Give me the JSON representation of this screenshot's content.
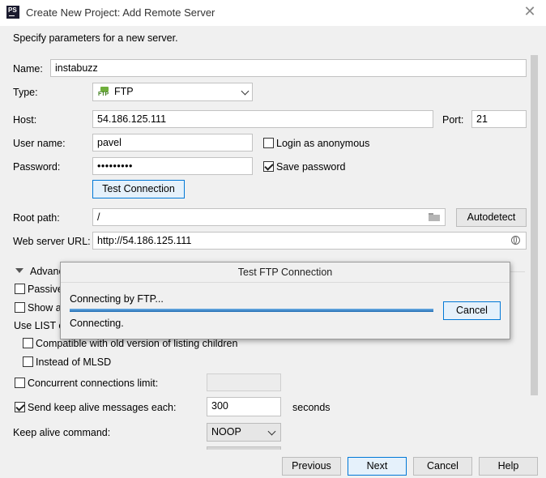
{
  "window": {
    "app_icon_text": "PS",
    "title": "Create New Project: Add Remote Server",
    "close_glyph": "✕"
  },
  "subtitle": "Specify parameters for a new server.",
  "form": {
    "name_label": "Name:",
    "name_value": "instabuzz",
    "type_label": "Type:",
    "type_value": "FTP",
    "type_icon_text": "FTP",
    "host_label": "Host:",
    "host_value": "54.186.125.111",
    "port_label": "Port:",
    "port_value": "21",
    "username_label": "User name:",
    "username_value": "pavel",
    "anonymous_label": "Login as anonymous",
    "anonymous_checked": false,
    "password_label": "Password:",
    "password_value": "•••••••••",
    "save_password_label": "Save password",
    "save_password_checked": true,
    "test_connection_label": "Test Connection",
    "root_path_label": "Root path:",
    "root_path_value": "/",
    "autodetect_label": "Autodetect",
    "web_url_label": "Web server URL:",
    "web_url_value": "http://54.186.125.111"
  },
  "advanced": {
    "header_label": "Advanc",
    "passive_label": "Passive",
    "show_label": "Show a",
    "use_list_label": "Use  LIST c",
    "compat_label": "Compatible with old version of listing children",
    "instead_mlsd_label": "Instead of MLSD",
    "concurrent_label": "Concurrent connections limit:",
    "concurrent_value": "",
    "keepalive_label": "Send keep alive messages each:",
    "keepalive_value": "300",
    "keepalive_unit": "seconds",
    "keepalive_checked": true,
    "keepalive_cmd_label": "Keep alive command:",
    "keepalive_cmd_value": "NOOP"
  },
  "popup": {
    "title": "Test FTP Connection",
    "status_top": "Connecting by FTP...",
    "status_bottom": "Connecting.",
    "cancel_label": "Cancel"
  },
  "footer": {
    "previous_label": "Previous",
    "next_label": "Next",
    "cancel_label": "Cancel",
    "help_label": "Help"
  },
  "colors": {
    "focus_border": "#0078d7",
    "progress": "#2f7fc1"
  }
}
